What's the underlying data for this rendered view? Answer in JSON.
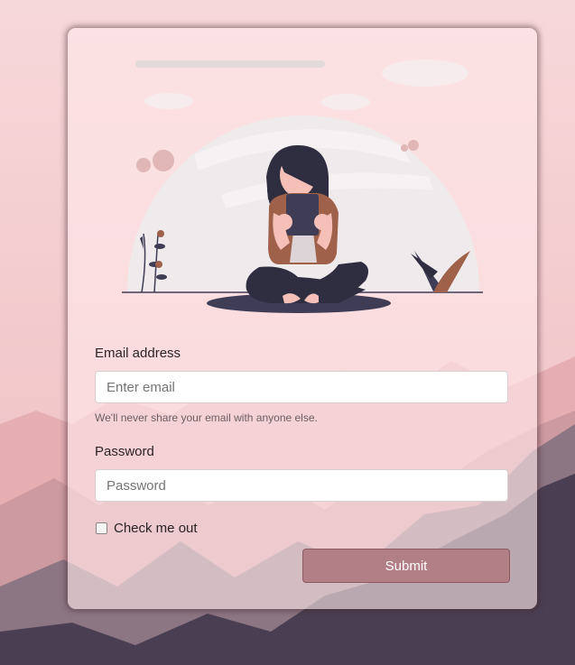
{
  "colors": {
    "background": "#f3cfd2",
    "card": "#fde6e8",
    "accent": "#b37f86",
    "text": "#2c2327"
  },
  "form": {
    "email_label": "Email address",
    "email_placeholder": "Enter email",
    "email_help": "We'll never share your email with anyone else.",
    "password_label": "Password",
    "password_placeholder": "Password",
    "remember_label": "Check me out",
    "submit_label": "Submit"
  }
}
